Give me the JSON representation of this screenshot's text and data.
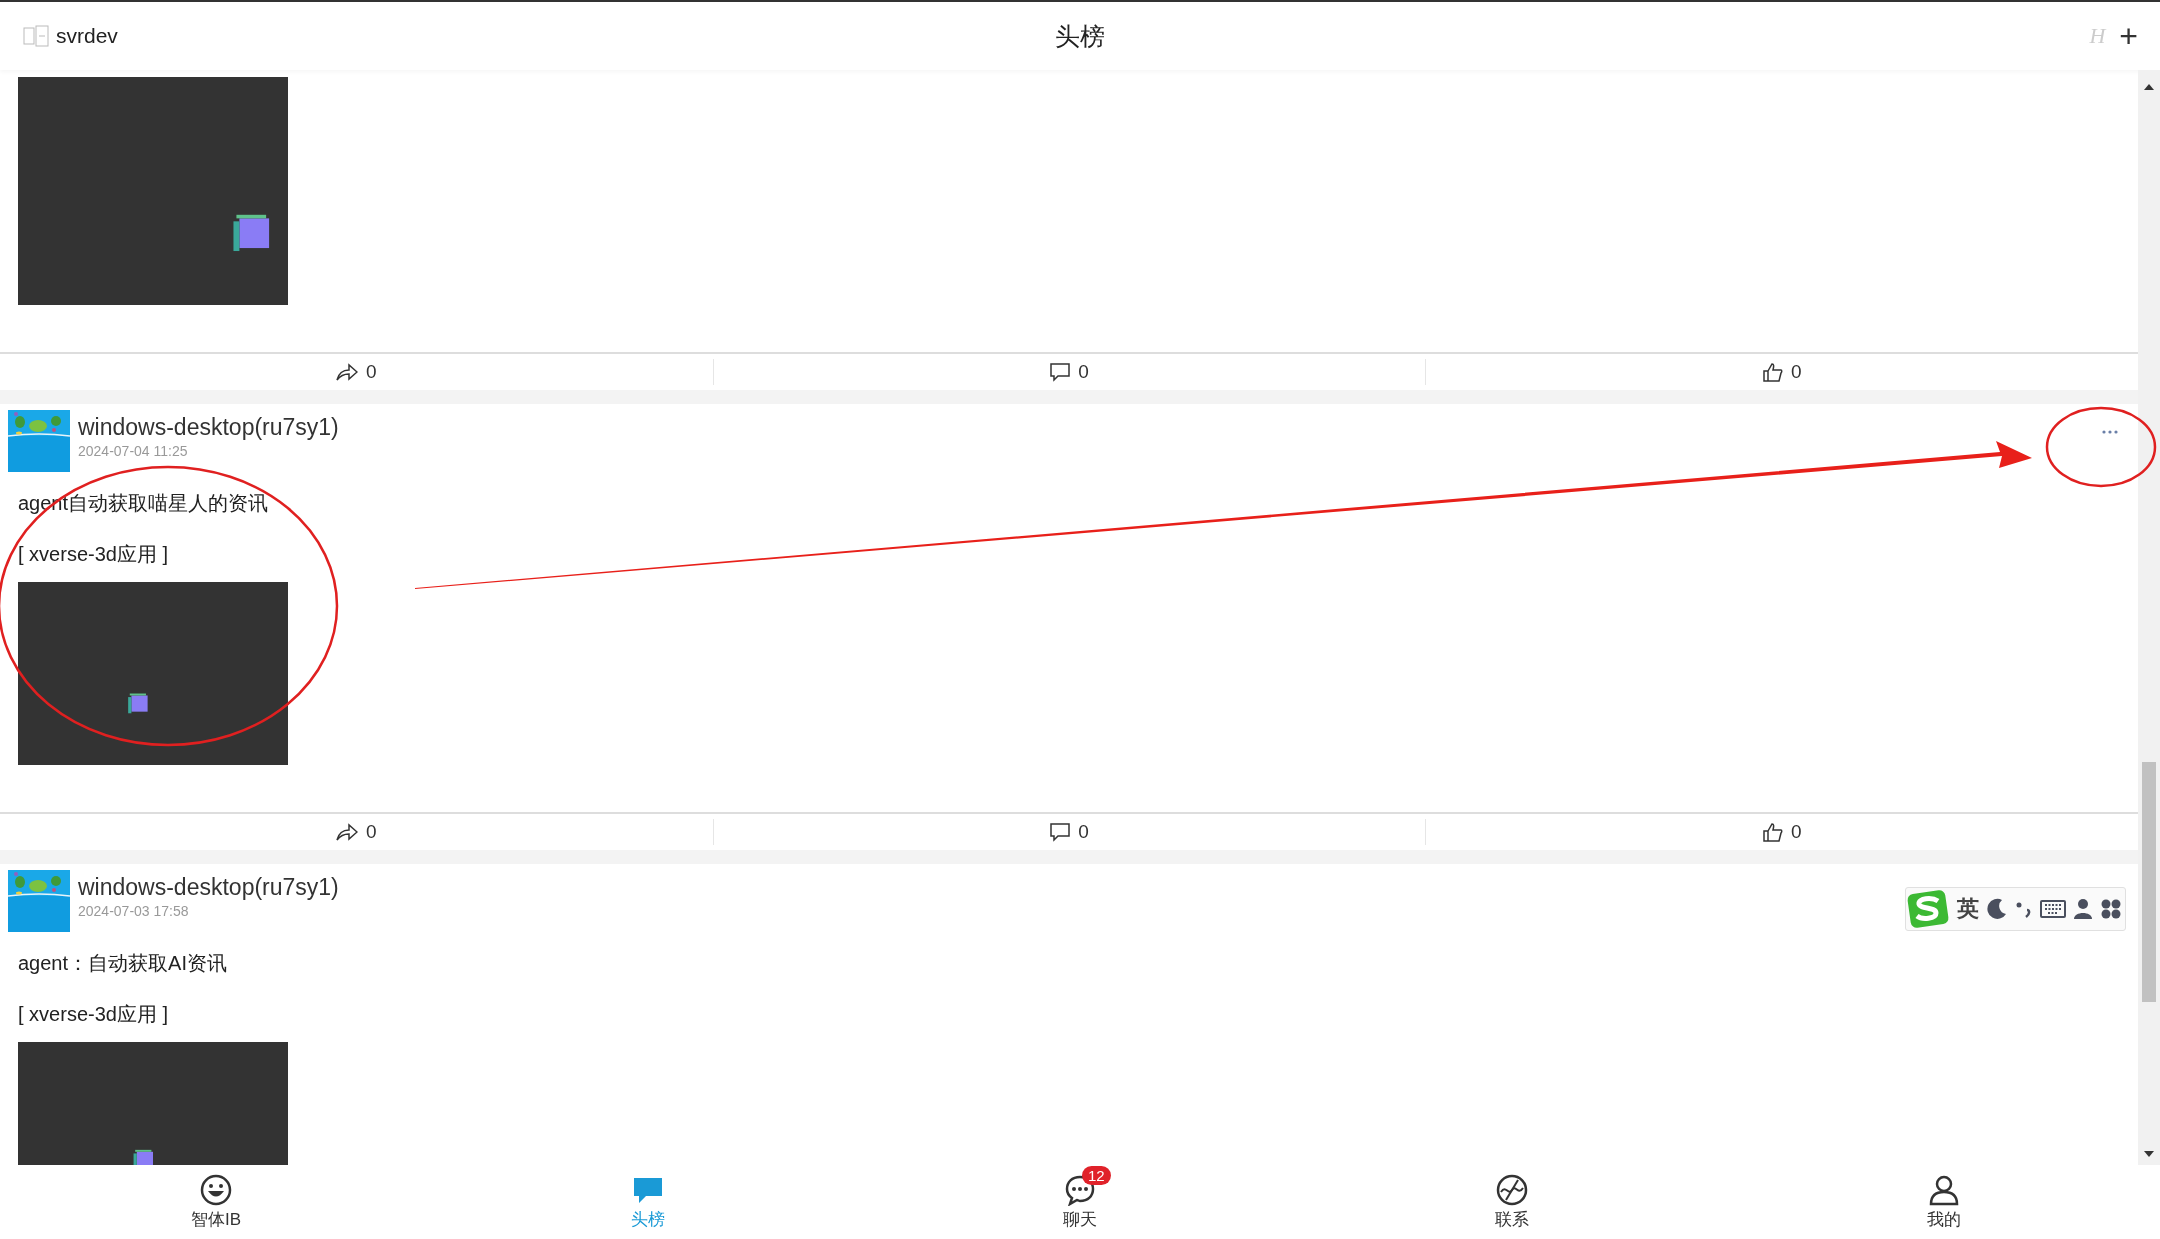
{
  "header": {
    "app_name": "svrdev",
    "title": "头榜",
    "h_label": "H",
    "add_label": "+"
  },
  "posts": [
    {
      "actions": [
        {
          "kind": "share",
          "count": "0"
        },
        {
          "kind": "comment",
          "count": "0"
        },
        {
          "kind": "like",
          "count": "0"
        }
      ]
    },
    {
      "author": "windows-desktop(ru7sy1)",
      "time": "2024-07-04 11:25",
      "text": "agent自动获取喵星人的资讯",
      "tag": "[ xverse-3d应用 ]",
      "actions": [
        {
          "kind": "share",
          "count": "0"
        },
        {
          "kind": "comment",
          "count": "0"
        },
        {
          "kind": "like",
          "count": "0"
        }
      ]
    },
    {
      "author": "windows-desktop(ru7sy1)",
      "time": "2024-07-03 17:58",
      "text": "agent：自动获取AI资讯",
      "tag": "[ xverse-3d应用 ]"
    }
  ],
  "nav": [
    {
      "label": "智体IB",
      "kind": "bot",
      "selected": false
    },
    {
      "label": "头榜",
      "kind": "feed",
      "selected": true
    },
    {
      "label": "聊天",
      "kind": "chat",
      "selected": false,
      "badge": "12"
    },
    {
      "label": "联系",
      "kind": "contacts",
      "selected": false
    },
    {
      "label": "我的",
      "kind": "profile",
      "selected": false
    }
  ],
  "ime_toolbar": {
    "mode": "英"
  }
}
